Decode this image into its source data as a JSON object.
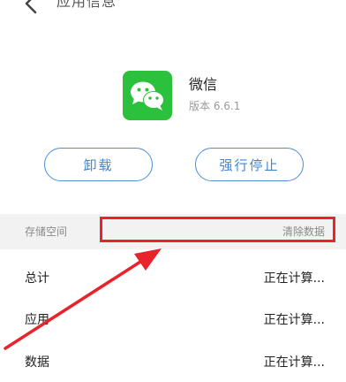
{
  "header": {
    "title": "应用信息"
  },
  "app": {
    "name": "微信",
    "version": "版本 6.6.1",
    "icon": "wechat-logo"
  },
  "actions": {
    "uninstall_label": "卸载",
    "force_stop_label": "强行停止"
  },
  "storage": {
    "section_label": "存储空间",
    "clear_data_label": "清除数据",
    "rows": [
      {
        "label": "总计",
        "value": "正在计算..."
      },
      {
        "label": "应用",
        "value": "正在计算..."
      },
      {
        "label": "数据",
        "value": "正在计算..."
      }
    ]
  },
  "colors": {
    "accent": "#3f86d1",
    "wechat_green": "#2bc13c",
    "annotation_red": "#e8232b"
  }
}
